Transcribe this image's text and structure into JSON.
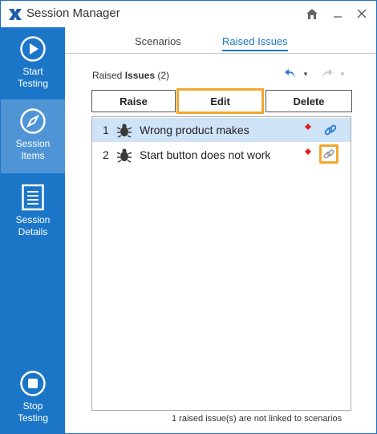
{
  "window": {
    "title": "Session Manager"
  },
  "colors": {
    "sidebar": "#1c76c8",
    "sidebar_active": "#4f95d6",
    "accent": "#1c76c8",
    "highlight": "#f0a830",
    "priority": "#e02020"
  },
  "sidebar": {
    "items": [
      {
        "label_line1": "Start",
        "label_line2": "Testing",
        "icon": "play-circle-icon"
      },
      {
        "label_line1": "Session",
        "label_line2": "Items",
        "icon": "compass-icon",
        "active": true
      },
      {
        "label_line1": "Session",
        "label_line2": "Details",
        "icon": "document-icon"
      },
      {
        "label_line1": "Stop",
        "label_line2": "Testing",
        "icon": "stop-circle-icon"
      }
    ]
  },
  "tabs": [
    {
      "label": "Scenarios"
    },
    {
      "label": "Raised Issues",
      "active": true
    }
  ],
  "panel": {
    "title_prefix": "Raised ",
    "title_bold": "Issues",
    "title_count": " (2)"
  },
  "buttons": {
    "raise": "Raise",
    "edit": "Edit",
    "delete": "Delete"
  },
  "issues": [
    {
      "num": "1",
      "title": "Wrong product makes",
      "icon": "bug-icon",
      "linked": true,
      "selected": true
    },
    {
      "num": "2",
      "title": "Start button does not work",
      "icon": "bug-icon",
      "linked": false,
      "selected": false
    }
  ],
  "status": "1 raised issue(s) are not linked to scenarios"
}
